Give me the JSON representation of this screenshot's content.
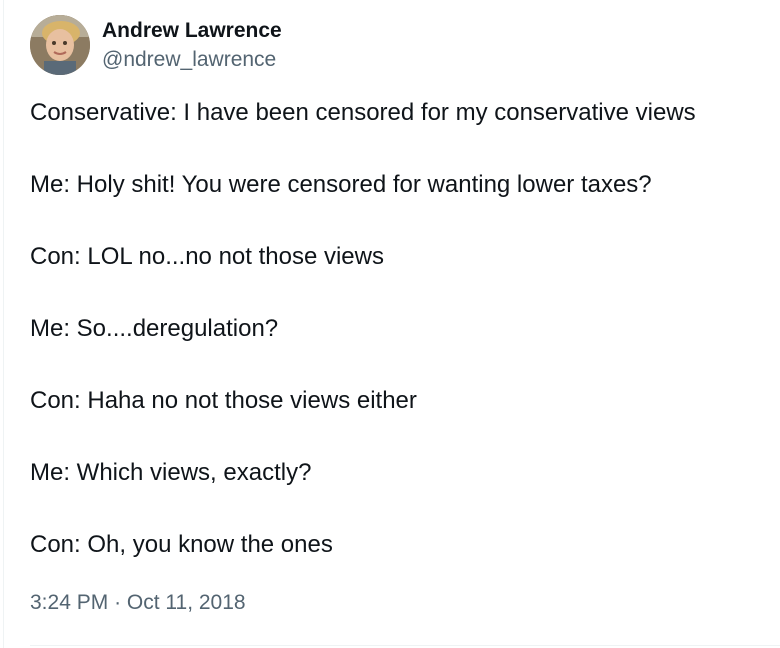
{
  "author": {
    "display_name": "Andrew Lawrence",
    "handle": "@ndrew_lawrence"
  },
  "tweet": {
    "lines": [
      "Conservative: I have been censored for my conservative views",
      "Me: Holy shit! You were censored for wanting lower taxes?",
      "Con: LOL no...no not those views",
      "Me: So....deregulation?",
      "Con: Haha no not those views either",
      "Me: Which views, exactly?",
      "Con: Oh, you know the ones"
    ],
    "time": "3:24 PM",
    "separator": "·",
    "date": "Oct 11, 2018"
  },
  "colors": {
    "text_primary": "#0f1419",
    "text_secondary": "#536471",
    "divider": "#eff3f4"
  },
  "icons": {
    "avatar": "profile-photo"
  }
}
